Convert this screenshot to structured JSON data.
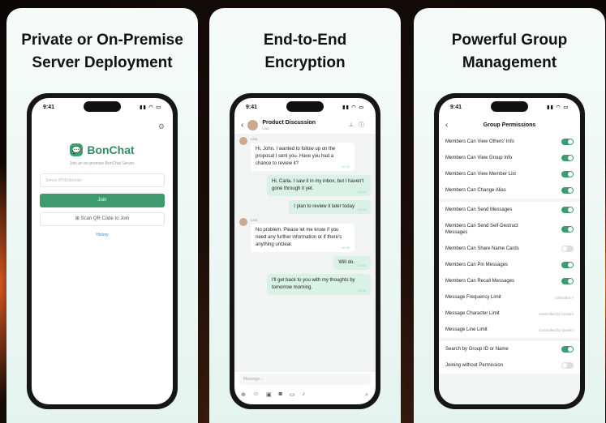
{
  "cards": {
    "c1": {
      "title": "Private or On-Premise\nServer Deployment"
    },
    "c2": {
      "title": "End-to-End\nEncryption"
    },
    "c3": {
      "title": "Powerful Group\nManagement"
    }
  },
  "status_time": "9:41",
  "phone1": {
    "app_name": "BonChat",
    "subtitle": "Join an on-premise BonChat Server.",
    "input_placeholder": "Server IP/ID/domain",
    "join_label": "Join",
    "qr_label": "Scan QR Code to Join",
    "history_label": "History"
  },
  "phone2": {
    "title": "Product Discussion",
    "subtitle": "Lisa",
    "composer_placeholder": "Message...",
    "messages": [
      {
        "from": "Lisa",
        "text": "Hi, John. I wanted to follow up on the proposal I sent you. Have you had a chance to review it?",
        "time": "10:32",
        "mine": false
      },
      {
        "text": "Hi, Carla. I saw it in my inbox, but I haven't gone through it yet.",
        "time": "10:33",
        "mine": true
      },
      {
        "text": "I plan to review it later today",
        "time": "10:35",
        "mine": true
      },
      {
        "from": "Lisa",
        "text": "No problem. Please let me know if you need any further information or if there's anything unclear.",
        "time": "10:35",
        "mine": false
      },
      {
        "text": "Will do.",
        "time": "10:35",
        "mine": true
      },
      {
        "text": "I'll get back to you with my thoughts by tomorrow morning.",
        "time": "10:36",
        "mine": true
      }
    ]
  },
  "phone3": {
    "title": "Group Permissions",
    "groups": [
      [
        {
          "label": "Members Can View Others' Info",
          "toggle": true
        },
        {
          "label": "Members Can View Group Info",
          "toggle": true
        },
        {
          "label": "Members Can View Member List",
          "toggle": true
        },
        {
          "label": "Members Can Change Alias",
          "toggle": true
        }
      ],
      [
        {
          "label": "Members Can Send Messages",
          "toggle": true
        },
        {
          "label": "Members Can Send Self-Destruct Messages",
          "toggle": true
        },
        {
          "label": "Members Can Share Name Cards",
          "toggle": false
        },
        {
          "label": "Members Can Pin Messages",
          "toggle": true
        },
        {
          "label": "Members Can Recall Messages",
          "toggle": true
        },
        {
          "label": "Message Frequency Limit",
          "value": "Unlimited >"
        },
        {
          "label": "Message Character Limit",
          "value": "Controlled by System"
        },
        {
          "label": "Message Line Limit",
          "value": "Controlled by System"
        }
      ],
      [
        {
          "label": "Search by Group ID or Name",
          "toggle": true
        },
        {
          "label": "Joining without Permission",
          "toggle": false
        }
      ]
    ]
  }
}
